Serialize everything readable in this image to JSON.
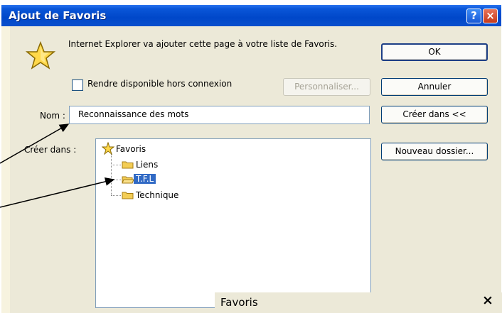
{
  "window": {
    "title": "Ajout de Favoris",
    "help_label": "?",
    "close_label": "×"
  },
  "message": "Internet Explorer va ajouter cette page à votre liste de Favoris.",
  "offline_checkbox": {
    "label": "Rendre disponible hors connexion",
    "checked": false
  },
  "buttons": {
    "ok": "OK",
    "cancel": "Annuler",
    "create_in": "Créer dans <<",
    "customize": "Personnaliser...",
    "new_folder": "Nouveau dossier..."
  },
  "name_field": {
    "label": "Nom :",
    "value": "Reconnaissance des mots"
  },
  "create_in_label": "Créer dans :",
  "tree": {
    "root": "Favoris",
    "children": [
      "Liens",
      "T.F.L",
      "Technique"
    ],
    "selected": "T.F.L"
  },
  "popup": {
    "title": "Favoris",
    "close": "×"
  },
  "colors": {
    "titlebar": "#0047c9",
    "selection": "#316ac5",
    "dialog_bg": "#ece9d8"
  }
}
